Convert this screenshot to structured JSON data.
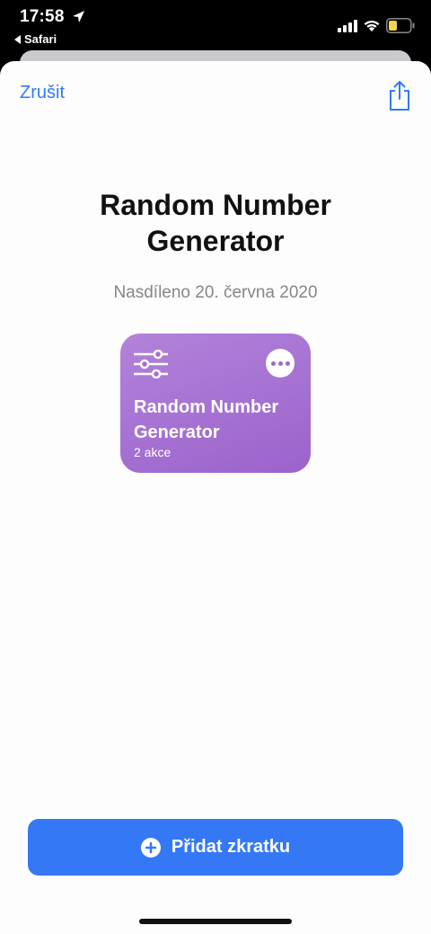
{
  "status_bar": {
    "time": "17:58",
    "back_app": "Safari"
  },
  "sheet": {
    "cancel_label": "Zrušit",
    "title": "Random Number Generator",
    "subtitle": "Nasdíleno 20. června 2020"
  },
  "card": {
    "name": "Random Number Generator",
    "actions": "2 akce",
    "gradient_start": "#b283da",
    "gradient_end": "#9b62cc"
  },
  "add_button": {
    "label": "Přidat zkratku",
    "color": "#3478f6"
  },
  "colors": {
    "accent": "#2d7cf6",
    "battery": "#f5d547"
  },
  "icons": [
    "location-icon",
    "back-arrow-icon",
    "signal-icon",
    "wifi-icon",
    "battery-icon",
    "share-icon",
    "sliders-icon",
    "more-icon",
    "plus-icon"
  ]
}
